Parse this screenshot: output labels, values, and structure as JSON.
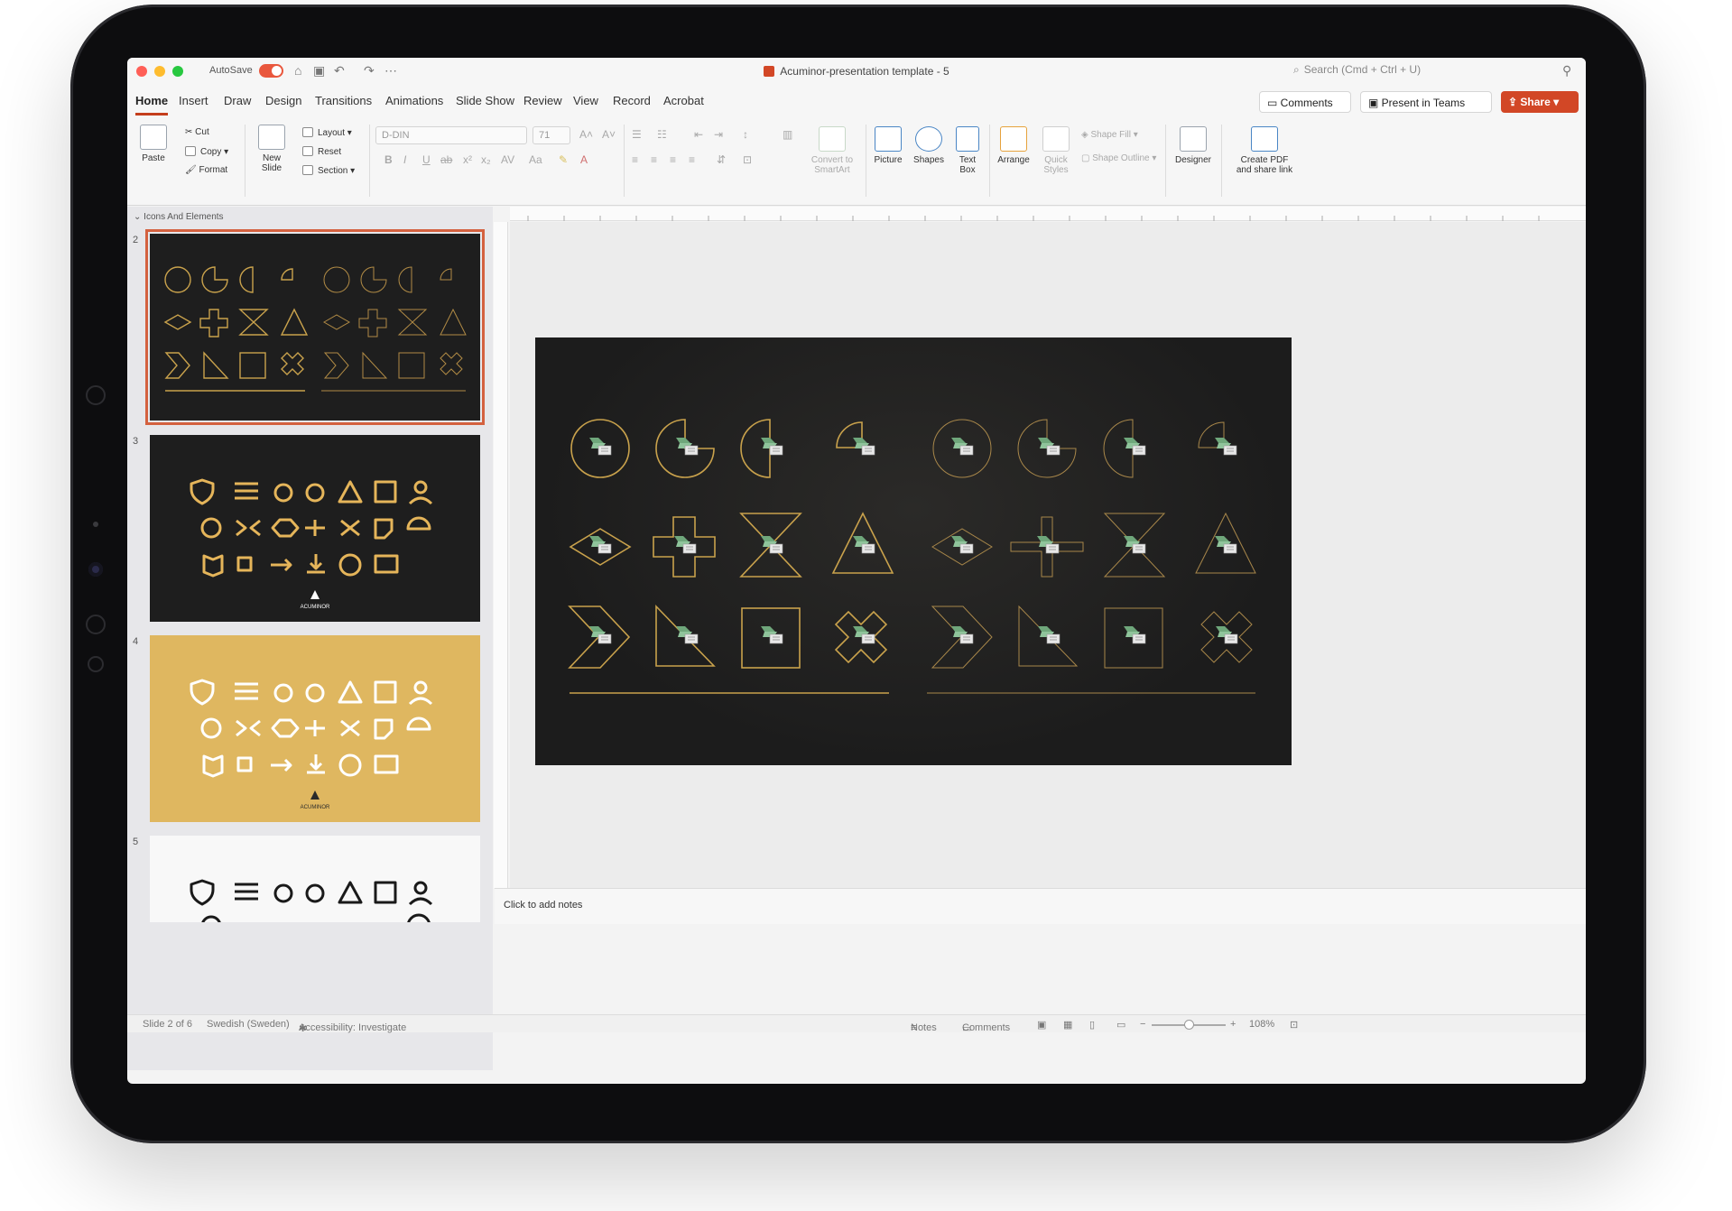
{
  "titlebar": {
    "autosave_label": "AutoSave",
    "document_title": "Acuminor-presentation template - 5",
    "search_placeholder": "Search (Cmd + Ctrl + U)",
    "colors": {
      "close": "#ff5f57",
      "minimize": "#febc2e",
      "zoom": "#28c840",
      "accent": "#d24726"
    }
  },
  "tabs": [
    "Home",
    "Insert",
    "Draw",
    "Design",
    "Transitions",
    "Animations",
    "Slide Show",
    "Review",
    "View",
    "Record",
    "Acrobat"
  ],
  "active_tab": "Home",
  "actions": {
    "comments": "Comments",
    "present": "Present in Teams",
    "share": "Share"
  },
  "ribbon": {
    "paste": "Paste",
    "cut": "Cut",
    "copy": "Copy",
    "format": "Format",
    "new_slide_1": "New",
    "new_slide_2": "Slide",
    "layout": "Layout",
    "reset": "Reset",
    "section": "Section",
    "font_name": "D-DIN",
    "font_size": "71",
    "convert_1": "Convert to",
    "convert_2": "SmartArt",
    "picture": "Picture",
    "shapes": "Shapes",
    "textbox_1": "Text",
    "textbox_2": "Box",
    "arrange": "Arrange",
    "quick_1": "Quick",
    "quick_2": "Styles",
    "shape_fill": "Shape Fill",
    "shape_outline": "Shape Outline",
    "designer": "Designer",
    "pdf_1": "Create PDF",
    "pdf_2": "and share link"
  },
  "slide_panel": {
    "section_title": "Icons And Elements",
    "slides": [
      {
        "number": "2",
        "theme": "dark-shapes",
        "selected": true
      },
      {
        "number": "3",
        "theme": "dark-icons",
        "logo": "ACUMINOR"
      },
      {
        "number": "4",
        "theme": "gold-icons",
        "logo": "ACUMINOR"
      },
      {
        "number": "5",
        "theme": "light-icons"
      }
    ]
  },
  "notes_placeholder": "Click to add notes",
  "status": {
    "slide_position": "Slide 2 of 6",
    "language": "Swedish (Sweden)",
    "accessibility": "Accessibility: Investigate",
    "notes": "Notes",
    "comments": "Comments",
    "zoom": "108%"
  },
  "colors": {
    "gold": "#c9a24c",
    "gold_light": "#d6b46b",
    "placeholder_green": "#6fa77b",
    "slide_bg": "#1c1c1c",
    "gold_slide": "#dfb760",
    "selection": "#d4613f"
  }
}
